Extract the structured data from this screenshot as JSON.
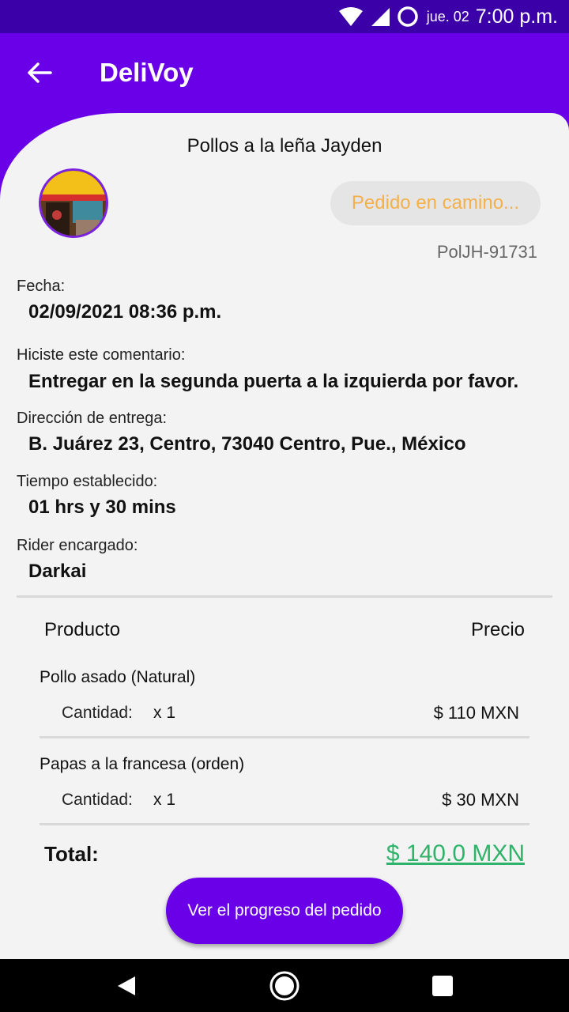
{
  "status_bar": {
    "date": "jue. 02",
    "time": "7:00 p.m.",
    "icons": [
      "wifi-icon",
      "signal-icon",
      "circle-icon"
    ]
  },
  "app_bar": {
    "title": "DeliVoy",
    "back_icon": "arrow-left-icon"
  },
  "order": {
    "restaurant": "Pollos a la leña Jayden",
    "status": "Pedido en camino...",
    "code": "PolJH-91731",
    "fields": [
      {
        "label": "Fecha:",
        "value": "02/09/2021 08:36 p.m."
      },
      {
        "label": "Hiciste este comentario:",
        "value": "Entregar en la segunda puerta a la izquierda por favor."
      },
      {
        "label": "Dirección de entrega:",
        "value": "B. Juárez 23, Centro, 73040 Centro, Pue., México"
      },
      {
        "label": "Tiempo establecido:",
        "value": "01 hrs y 30 mins"
      },
      {
        "label": "Rider encargado:",
        "value": "Darkai"
      }
    ],
    "table": {
      "headers": {
        "product": "Producto",
        "price": "Precio"
      },
      "items": [
        {
          "name": "Pollo asado (Natural)",
          "qty_label": "Cantidad:",
          "qty": "x 1",
          "price": "$ 110 MXN"
        },
        {
          "name": "Papas a la francesa (orden)",
          "qty_label": "Cantidad:",
          "qty": "x 1",
          "price": "$ 30 MXN"
        }
      ]
    },
    "total_label": "Total:",
    "total_value": "$ 140.0 MXN",
    "button_label": "Ver el progreso del pedido"
  },
  "colors": {
    "primary": "#6a00e8",
    "status_bar": "#3c00a8",
    "status_text": "#f4b04a",
    "total": "#2fb36a",
    "card": "#f3f3f3"
  },
  "nav_bar": {
    "icons": [
      "back-triangle-icon",
      "home-circle-icon",
      "recents-square-icon"
    ]
  }
}
